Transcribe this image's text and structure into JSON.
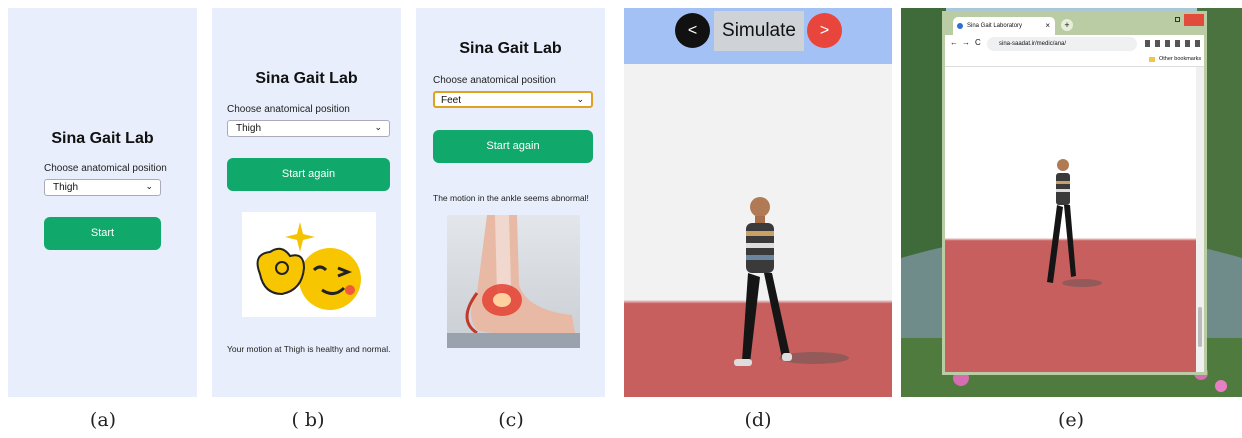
{
  "panel_a": {
    "title": "Sina Gait Lab",
    "prompt": "Choose anatomical position",
    "select_value": "Thigh",
    "button": "Start"
  },
  "panel_b": {
    "title": "Sina Gait Lab",
    "prompt": "Choose anatomical position",
    "select_value": "Thigh",
    "button": "Start again",
    "message": "Your motion at Thigh is healthy and normal."
  },
  "panel_c": {
    "title": "Sina Gait Lab",
    "prompt": "Choose anatomical position",
    "select_value": "Feet",
    "button": "Start again",
    "message": "The motion in the ankle seems abnormal!"
  },
  "panel_d": {
    "prev": "<",
    "label": "Simulate",
    "next": ">"
  },
  "panel_e": {
    "tab_title": "Sina Gait Laboratory",
    "url": "sina-saadat.ir/medic/ana/",
    "bookmarks": "Other bookmarks",
    "nav_back": "←",
    "nav_forward": "→",
    "nav_reload": "C",
    "new_tab": "+",
    "tab_close": "×"
  },
  "captions": [
    "(a)",
    "( b)",
    "(c)",
    "(d)",
    "(e)"
  ],
  "colors": {
    "app_bg": "#e8eefb",
    "button_green": "#11a86b",
    "floor": "#c85f5f",
    "sim_header": "#a3c1f5",
    "prev_btn": "#111111",
    "next_btn": "#e8453c"
  }
}
